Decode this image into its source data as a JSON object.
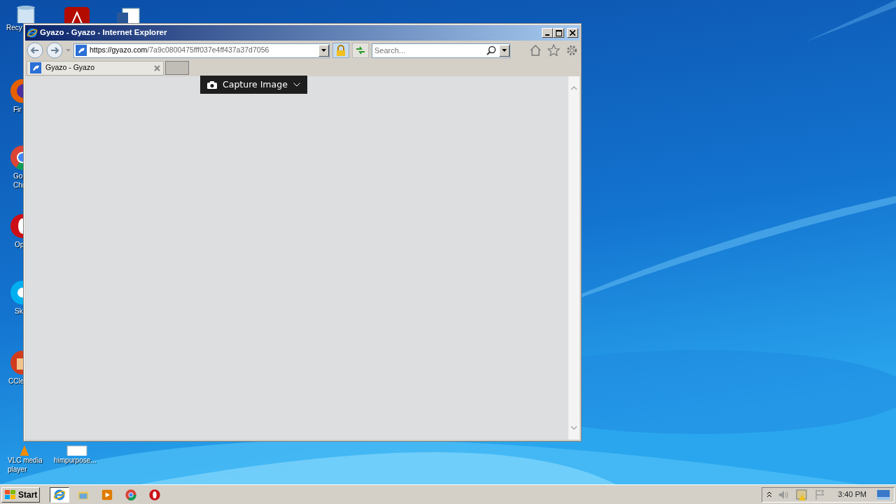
{
  "desktop": {
    "icons": [
      {
        "kind": "recycle",
        "lines": [
          "Recy"
        ]
      },
      {
        "kind": "pdf"
      },
      {
        "kind": "word"
      },
      {
        "kind": "firefox",
        "lines": [
          "Fir"
        ]
      },
      {
        "kind": "chrome",
        "lines": [
          "Go",
          "Chr"
        ]
      },
      {
        "kind": "opera",
        "lines": [
          "Op"
        ]
      },
      {
        "kind": "skype",
        "lines": [
          "Sk"
        ]
      },
      {
        "kind": "ccleaner",
        "lines": [
          "CCle"
        ]
      },
      {
        "kind": "vlc",
        "lines": [
          "VLC media",
          "player"
        ]
      },
      {
        "kind": "file",
        "lines": [
          "himpurpose..."
        ]
      }
    ]
  },
  "window": {
    "title": "Gyazo - Gyazo - Internet Explorer",
    "address": {
      "host": "https://gyazo.com",
      "path": "/7a9c0800475fff037e4ff437a37d7056"
    },
    "search": {
      "placeholder": "Search..."
    },
    "tabs": [
      {
        "label": "Gyazo - Gyazo",
        "selected": true
      }
    ],
    "popup": {
      "label": "Capture Image"
    }
  },
  "taskbar": {
    "start": "Start",
    "items": [
      {
        "kind": "ie",
        "selected": true
      },
      {
        "kind": "explorer",
        "selected": false
      },
      {
        "kind": "media",
        "selected": false
      },
      {
        "kind": "chrome",
        "selected": false
      },
      {
        "kind": "opera",
        "selected": false
      }
    ],
    "clock": "3:40 PM"
  }
}
